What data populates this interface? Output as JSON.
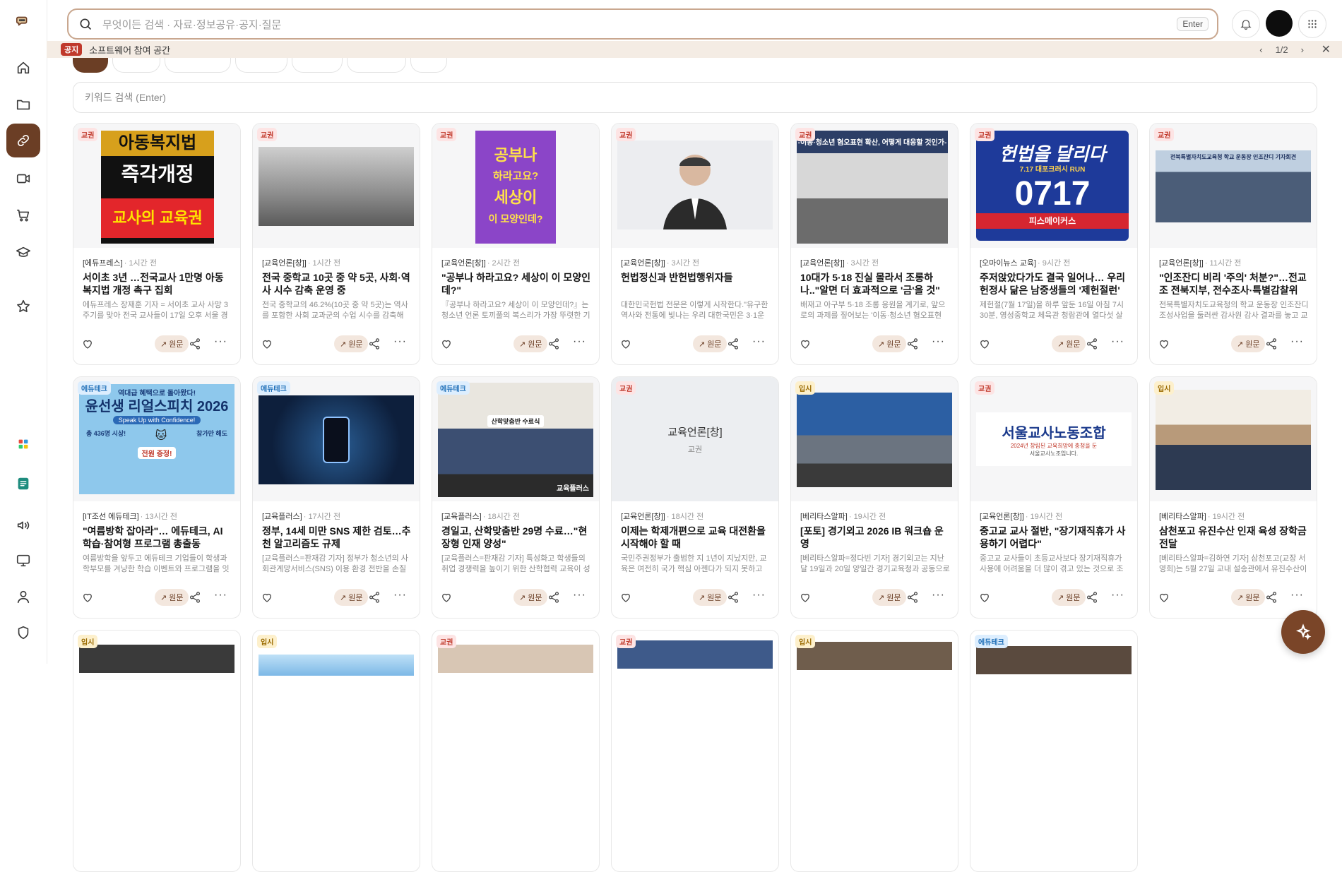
{
  "search": {
    "placeholder": "무엇이든 검색 · 자료·정보공유·공지·질문",
    "enter_label": "Enter"
  },
  "notice": {
    "tag": "공지",
    "text": "소프트웨어 참여 공간",
    "pager": "1/2"
  },
  "keyword": {
    "placeholder": "키워드 검색 (Enter)"
  },
  "card_actions": {
    "original_label": "원문"
  },
  "cards": [
    {
      "category": "교권",
      "source": "[에듀프레스]",
      "time": "· 1시간 전",
      "title": "서이초 3년 …전국교사 1만명 아동복지법 개정 촉구 집회",
      "summary": "에듀프레스 장재훈 기자 = 서이초 교사 사망 3주기를 맞아 전국 교사들이 17일 오후 서울 경복궁역 …",
      "img_lines": [
        "아동복지법",
        "즉각개정",
        "교사의 교육권"
      ]
    },
    {
      "category": "교권",
      "source": "[교육언론[창]]",
      "time": "· 1시간 전",
      "title": "전국 중학교 10곳 중 약 5곳, 사회·역사 시수 감축 운영 중",
      "summary": "전국 중학교의 46.2%(10곳 중 약 5곳)는 역사를 포함한 사회 교과군의 수업 시수를 감축해 운영하…"
    },
    {
      "category": "교권",
      "source": "[교육언론[창]]",
      "time": "· 2시간 전",
      "title": "\"공부나 하라고요? 세상이 이 모양인데?\"",
      "summary": "『공부나 하라고요? 세상이 이 모양인데?』는 청소년 언론 토끼풀의 복스리가 가장 뚜렷한 기사들을 모…",
      "img_lines": [
        "공부나",
        "하라고요?",
        "세상이",
        "이 모양인데?"
      ]
    },
    {
      "category": "교권",
      "source": "[교육언론[창]]",
      "time": "· 3시간 전",
      "title": "헌법정신과 반헌법행위자들",
      "summary": "대한민국헌법 전문은 이렇게 시작한다.\"유구한 역사와 전통에 빛나는 우리 대한국민은 3·1운동으…"
    },
    {
      "category": "교권",
      "source": "[교육언론[창]]",
      "time": "· 3시간 전",
      "title": "10대가 5·18 진실 몰라서 조롱하나..\"알면 더 효과적으로 '금'을 것\"",
      "summary": "배재고 아구부 5·18 조롱 응원을 계기로, 앞으로의 과제를 짚어보는 '이동·청소년 혐오표현 확산, 어…",
      "img_lines": [
        "-이동·청소년 혐오표현 확산, 어떻게 대응할 것인가-"
      ]
    },
    {
      "category": "교권",
      "source": "[오마이뉴스 교육]",
      "time": "· 9시간 전",
      "title": "주저앉았다가도 결국 일어나… 우리 헌정사 닮은 남중생들의 '제헌절런'",
      "summary": "제헌절(7월 17일)을 하루 앞둔 16일 아침 7시 30분, 영성중학교 체육관 청람관에 열다섯 살들이 …",
      "img_lines": [
        "헌법을 달리다",
        "7.17 대포크러시 RUN",
        "0717",
        "피스메이커스"
      ]
    },
    {
      "category": "교권",
      "source": "[교육언론[창]]",
      "time": "· 11시간 전",
      "title": "\"인조잔디 비리 '주의' 처분?\"…전교조 전북지부, 전수조사·특별감찰위 촉구",
      "summary": "전북특별자치도교육청의 학교 운동장 인조잔디 조성사업을 둘러싼 감사원 감사 결과를 놓고 교육 …",
      "img_lines": [
        "전북특별자치도교육청 학교 운동장 인조잔디 기자회견"
      ]
    },
    {
      "category": "에듀테크",
      "source": "[IT조선 에듀테크]",
      "time": "· 13시간 전",
      "title": "\"여름방학 잡아라\"… 에듀테크, AI 학습·참여형 프로그램 총출동",
      "summary": "여름방학을 앞두고 에듀테크 기업들이 학생과 학부모를 겨냥한 학습 이벤트와 프로그램을 잇달아 선…",
      "img_lines": [
        "역대급 혜택으로 돌아왔다!",
        "윤선생 리얼스피치 2026",
        "Speak Up with Confidence!",
        "참가만 해도",
        "총 436명 시상!",
        "전원 증정!"
      ]
    },
    {
      "category": "에듀테크",
      "source": "[교육플러스]",
      "time": "· 17시간 전",
      "title": "정부, 14세 미만 SNS 제한 검토…추천 알고리즘도 규제",
      "summary": "[교육플러스=판재감 기자] 정부가 청소년의 사회관계망서비스(SNS) 이용 환경 전반을 손질하는 방…"
    },
    {
      "category": "에듀테크",
      "source": "[교육플러스]",
      "time": "· 18시간 전",
      "title": "경일고, 산학맞춤반 29명 수료…\"현장형 인재 양성\"",
      "summary": "[교육플러스=판재감 기자] 특성화고 학생들의 취업 경쟁력을 높이기 위한 산학협력 교육이 성과를 내…",
      "img_lines": [
        "산학맞춤반 수료식",
        "교육플러스"
      ]
    },
    {
      "category": "교권",
      "source": "[교육언론[창]]",
      "time": "· 18시간 전",
      "title": "이제는 학제개편으로 교육 대전환을 시작해야 할 때",
      "summary": "국민주권정부가 출범한 지 1년이 지났지만, 교육은 여전히 국가 핵심 아젠다가 되지 못하고 있다. 인…",
      "img_lines": [
        "교육언론[창]",
        "교권"
      ]
    },
    {
      "category": "입시",
      "source": "[베리타스알파]",
      "time": "· 19시간 전",
      "title": "[포토] 경기외고 2026 IB 워크숍 운영",
      "summary": "[베리타스알파=정다빈 기자] 경기외고는 지난달 19일과 20일 양일간 경기교육청과 공동으로 20…"
    },
    {
      "category": "교권",
      "source": "[교육언론[창]]",
      "time": "· 19시간 전",
      "title": "중고교 교사 절반, \"장기재직휴가 사용하기 어렵다\"",
      "summary": "중고교 교사들이 초등교사보다 장기재직휴가 사용에 어려움을 더 많이 겪고 있는 것으로 조사되었…",
      "img_lines": [
        "서울교사노동조합",
        "2024년 창립된 교육희망에 충청을 둔 ",
        "서울교사노조입니다."
      ]
    },
    {
      "category": "입시",
      "source": "[베리타스알파]",
      "time": "· 19시간 전",
      "title": "삼천포고 유진수산 인재 육성 장학금 전달",
      "summary": "[베리타스알파=김하연 기자] 삼천포고(교장 서영희)는 5월 27일 교내 설송관에서 유진수산이 주…"
    },
    {
      "category": "입시"
    },
    {
      "category": "입시"
    },
    {
      "category": "교권"
    },
    {
      "category": "교권"
    },
    {
      "category": "입시"
    },
    {
      "category": "에듀테크"
    }
  ]
}
